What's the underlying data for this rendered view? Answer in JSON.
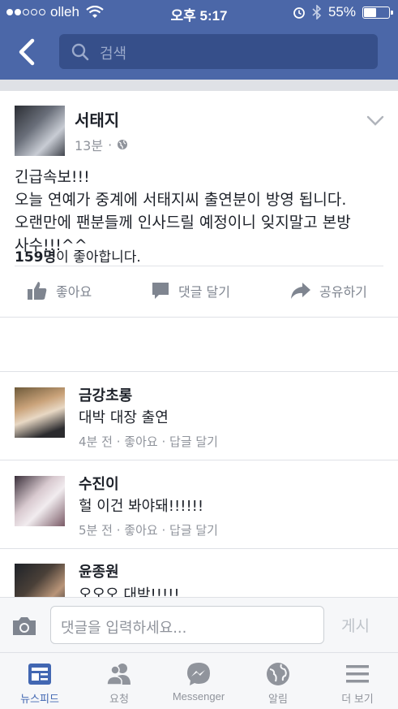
{
  "status_bar": {
    "carrier": "olleh",
    "time": "오후 5:17",
    "battery_percent": "55%",
    "battery_level": 0.55
  },
  "nav": {
    "search_placeholder": "검색"
  },
  "post": {
    "author": "서태지",
    "time": "13분",
    "separator": "·",
    "text": "긴급속보!!!\n오늘 연예가 중계에 서태지씨 출연분이 방영 됩니다.\n오랜만에 팬분들께 인사드릴 예정이니 잊지말고 본방\n사수!!!^^"
  },
  "actions": {
    "like": "좋아요",
    "comment": "댓글 달기",
    "share": "공유하기"
  },
  "likes_summary": {
    "count": "159명",
    "suffix": "이 좋아합니다."
  },
  "comments": [
    {
      "name": "금강초롱",
      "text": "대박 대장 출연",
      "time": "4분 전",
      "like": "좋아요",
      "reply": "답글 달기",
      "sep": "·"
    },
    {
      "name": "수진이",
      "text": "헐 이건 봐야돼!!!!!!",
      "time": "5분 전",
      "like": "좋아요",
      "reply": "답글 달기",
      "sep": "·"
    },
    {
      "name": "윤종원",
      "text": "오오오 대박!!!!!"
    }
  ],
  "comment_input": {
    "placeholder": "댓글을 입력하세요...",
    "post_label": "게시"
  },
  "tabs": [
    {
      "label": "뉴스피드",
      "icon": "news-feed-icon",
      "active": true
    },
    {
      "label": "요청",
      "icon": "friend-requests-icon"
    },
    {
      "label": "Messenger",
      "icon": "messenger-icon"
    },
    {
      "label": "알림",
      "icon": "notifications-globe-icon"
    },
    {
      "label": "더 보기",
      "icon": "menu-icon"
    }
  ],
  "colors": {
    "brand": "#4b67a8",
    "search_bg": "#364f8a",
    "active_tab": "#4267b2",
    "muted": "#90949c"
  }
}
